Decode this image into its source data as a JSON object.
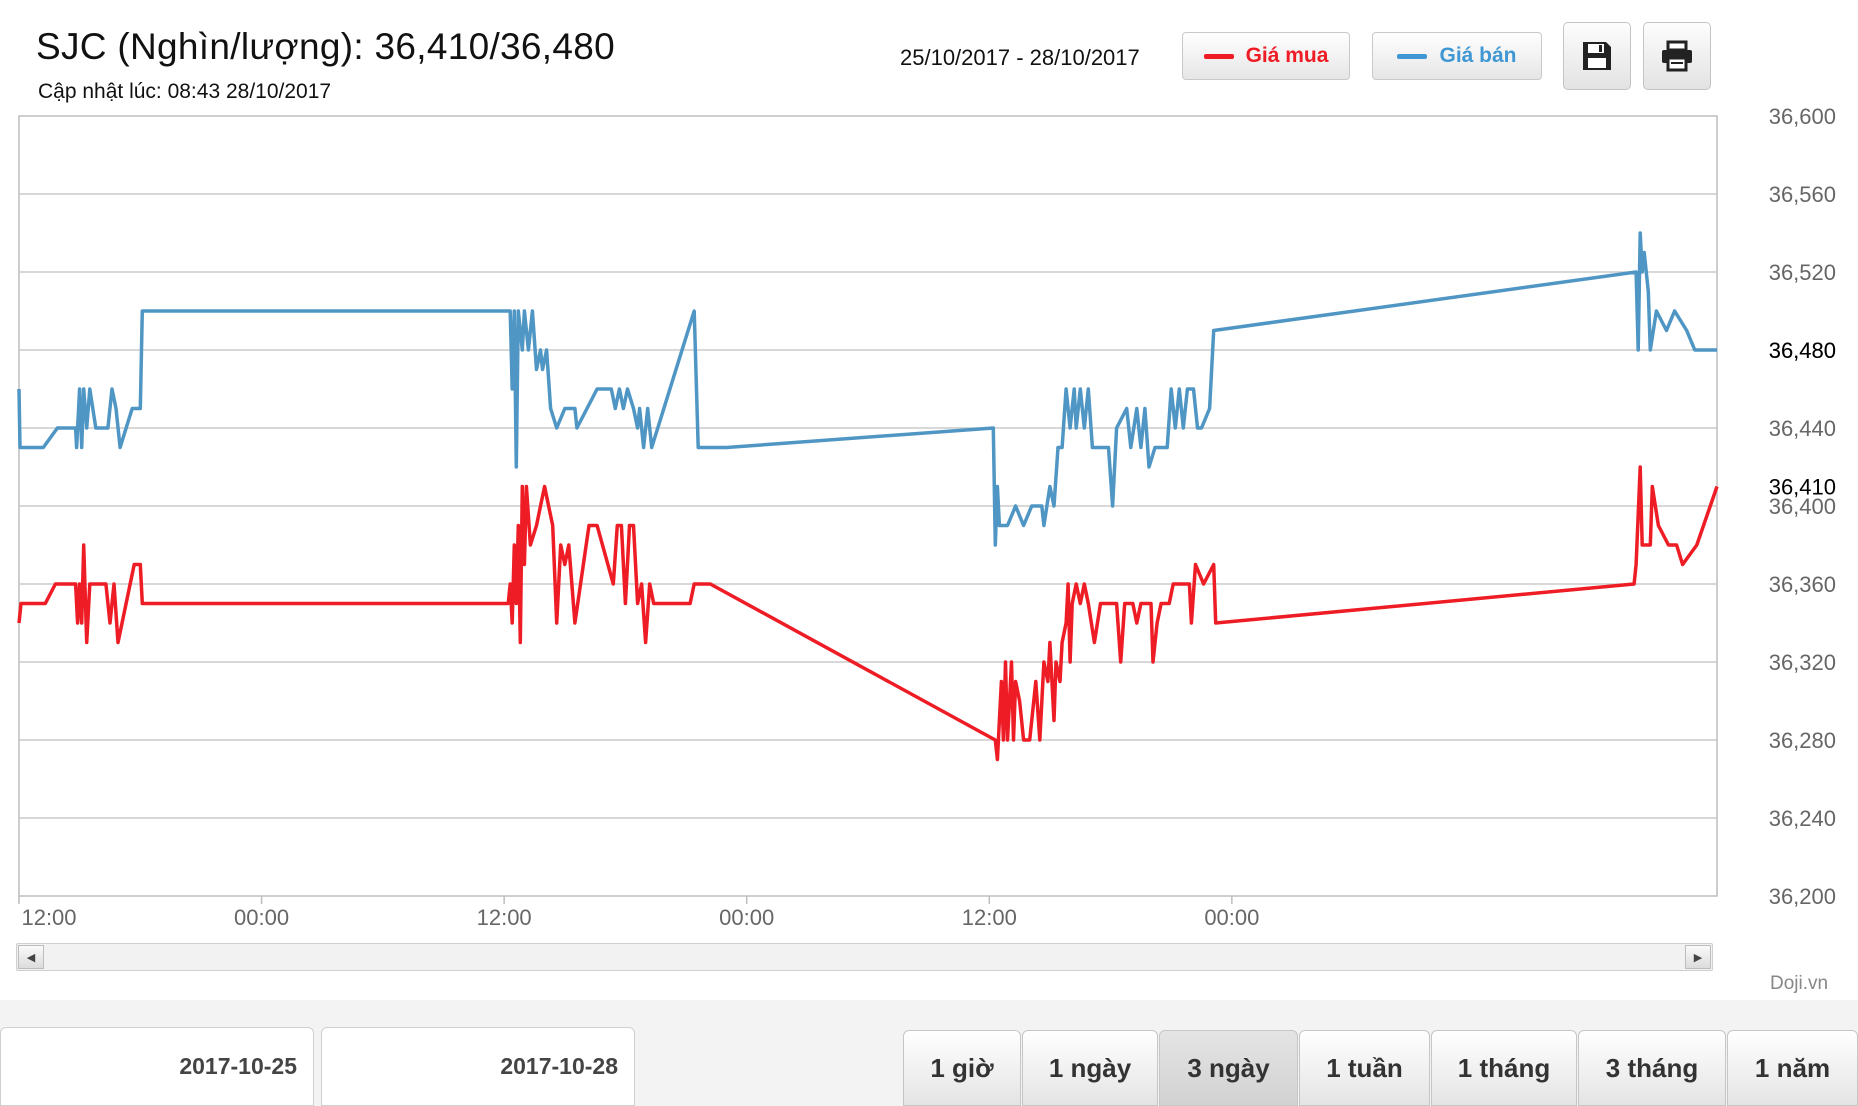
{
  "header": {
    "title": "SJC (Nghìn/lượng): 36,410/36,480",
    "updated": "Cập nhật lúc: 08:43 28/10/2017",
    "date_range": "25/10/2017 - 28/10/2017"
  },
  "legend": {
    "buy_label": "Giá mua",
    "sell_label": "Giá bán"
  },
  "toolbar": {
    "save_icon": "save-icon",
    "print_icon": "print-icon"
  },
  "watermark": "Doji.vn",
  "date_inputs": {
    "from": "2017-10-25",
    "to": "2017-10-28"
  },
  "ranges": [
    "1 giờ",
    "1 ngày",
    "3 ngày",
    "1 tuần",
    "1 tháng",
    "3 tháng",
    "1 năm"
  ],
  "active_range": "3 ngày",
  "colors": {
    "buy": "#ee1c25",
    "sell": "#4f96c4",
    "grid": "#cccccc"
  },
  "chart_data": {
    "type": "line",
    "ylim": [
      36200,
      36600
    ],
    "y_ticks": [
      "36,200",
      "36,240",
      "36,280",
      "36,320",
      "36,360",
      "36,400",
      "36,440",
      "36,480",
      "36,520",
      "36,560",
      "36,600"
    ],
    "x_ticks": [
      "12:00",
      "00:00",
      "12:00",
      "00:00",
      "12:00",
      "00:00"
    ],
    "x_unit": "hours from 25/10/2017 12:00",
    "xlim": [
      0,
      84
    ],
    "current": {
      "buy": 36410,
      "sell": 36480,
      "buy_label": "36,410",
      "sell_label": "36,480"
    },
    "series": [
      {
        "name": "Giá bán",
        "points": [
          [
            0,
            36460
          ],
          [
            0.05,
            36430
          ],
          [
            1.2,
            36430
          ],
          [
            1.9,
            36440
          ],
          [
            2.8,
            36440
          ],
          [
            2.85,
            36430
          ],
          [
            3.0,
            36460
          ],
          [
            3.1,
            36430
          ],
          [
            3.2,
            36460
          ],
          [
            3.35,
            36440
          ],
          [
            3.5,
            36460
          ],
          [
            3.8,
            36440
          ],
          [
            4.4,
            36440
          ],
          [
            4.6,
            36460
          ],
          [
            4.8,
            36450
          ],
          [
            5.0,
            36430
          ],
          [
            5.6,
            36450
          ],
          [
            6.0,
            36450
          ],
          [
            6.1,
            36500
          ],
          [
            24.3,
            36500
          ],
          [
            24.4,
            36460
          ],
          [
            24.5,
            36500
          ],
          [
            24.6,
            36420
          ],
          [
            24.7,
            36500
          ],
          [
            24.9,
            36480
          ],
          [
            25.0,
            36500
          ],
          [
            25.2,
            36480
          ],
          [
            25.4,
            36500
          ],
          [
            25.6,
            36470
          ],
          [
            25.8,
            36480
          ],
          [
            25.9,
            36470
          ],
          [
            26.1,
            36480
          ],
          [
            26.3,
            36450
          ],
          [
            26.6,
            36440
          ],
          [
            27.0,
            36450
          ],
          [
            27.5,
            36450
          ],
          [
            27.6,
            36440
          ],
          [
            28.6,
            36460
          ],
          [
            29.3,
            36460
          ],
          [
            29.5,
            36450
          ],
          [
            29.7,
            36460
          ],
          [
            29.9,
            36450
          ],
          [
            30.1,
            36460
          ],
          [
            30.4,
            36450
          ],
          [
            30.6,
            36440
          ],
          [
            30.7,
            36450
          ],
          [
            30.9,
            36430
          ],
          [
            31.1,
            36450
          ],
          [
            31.3,
            36430
          ],
          [
            33.4,
            36500
          ],
          [
            33.6,
            36430
          ],
          [
            35.0,
            36430
          ],
          [
            48.2,
            36440
          ],
          [
            48.3,
            36380
          ],
          [
            48.4,
            36410
          ],
          [
            48.5,
            36390
          ],
          [
            48.9,
            36390
          ],
          [
            49.3,
            36400
          ],
          [
            49.7,
            36390
          ],
          [
            50.1,
            36400
          ],
          [
            50.6,
            36400
          ],
          [
            50.7,
            36390
          ],
          [
            51.0,
            36410
          ],
          [
            51.2,
            36400
          ],
          [
            51.4,
            36430
          ],
          [
            51.6,
            36430
          ],
          [
            51.8,
            36460
          ],
          [
            52.0,
            36440
          ],
          [
            52.2,
            36460
          ],
          [
            52.3,
            36440
          ],
          [
            52.5,
            36460
          ],
          [
            52.7,
            36440
          ],
          [
            52.9,
            36460
          ],
          [
            53.1,
            36430
          ],
          [
            53.9,
            36430
          ],
          [
            54.1,
            36400
          ],
          [
            54.3,
            36440
          ],
          [
            54.8,
            36450
          ],
          [
            55.0,
            36430
          ],
          [
            55.3,
            36450
          ],
          [
            55.5,
            36430
          ],
          [
            55.7,
            36450
          ],
          [
            55.9,
            36420
          ],
          [
            56.2,
            36430
          ],
          [
            56.8,
            36430
          ],
          [
            57.0,
            36460
          ],
          [
            57.2,
            36440
          ],
          [
            57.4,
            36460
          ],
          [
            57.6,
            36440
          ],
          [
            57.8,
            36460
          ],
          [
            58.1,
            36460
          ],
          [
            58.3,
            36440
          ],
          [
            58.5,
            36440
          ],
          [
            58.9,
            36450
          ],
          [
            59.1,
            36490
          ],
          [
            80.0,
            36520
          ],
          [
            80.1,
            36480
          ],
          [
            80.2,
            36540
          ],
          [
            80.3,
            36520
          ],
          [
            80.4,
            36530
          ],
          [
            80.6,
            36510
          ],
          [
            80.7,
            36480
          ],
          [
            81.0,
            36500
          ],
          [
            81.5,
            36490
          ],
          [
            81.9,
            36500
          ],
          [
            82.5,
            36490
          ],
          [
            82.9,
            36480
          ],
          [
            84.0,
            36480
          ]
        ]
      },
      {
        "name": "Giá mua",
        "points": [
          [
            0,
            36340
          ],
          [
            0.1,
            36350
          ],
          [
            1.3,
            36350
          ],
          [
            1.8,
            36360
          ],
          [
            2.8,
            36360
          ],
          [
            2.9,
            36340
          ],
          [
            3.0,
            36360
          ],
          [
            3.1,
            36340
          ],
          [
            3.2,
            36380
          ],
          [
            3.35,
            36330
          ],
          [
            3.5,
            36360
          ],
          [
            3.8,
            36360
          ],
          [
            4.3,
            36360
          ],
          [
            4.5,
            36340
          ],
          [
            4.7,
            36360
          ],
          [
            4.9,
            36330
          ],
          [
            5.3,
            36350
          ],
          [
            5.7,
            36370
          ],
          [
            6.0,
            36370
          ],
          [
            6.1,
            36350
          ],
          [
            24.2,
            36350
          ],
          [
            24.3,
            36360
          ],
          [
            24.4,
            36340
          ],
          [
            24.5,
            36380
          ],
          [
            24.6,
            36350
          ],
          [
            24.7,
            36390
          ],
          [
            24.8,
            36330
          ],
          [
            24.9,
            36410
          ],
          [
            25.0,
            36370
          ],
          [
            25.1,
            36410
          ],
          [
            25.3,
            36380
          ],
          [
            25.6,
            36390
          ],
          [
            25.8,
            36400
          ],
          [
            26.0,
            36410
          ],
          [
            26.2,
            36400
          ],
          [
            26.4,
            36390
          ],
          [
            26.6,
            36340
          ],
          [
            26.8,
            36380
          ],
          [
            27.0,
            36370
          ],
          [
            27.2,
            36380
          ],
          [
            27.5,
            36340
          ],
          [
            28.2,
            36390
          ],
          [
            28.6,
            36390
          ],
          [
            29.4,
            36360
          ],
          [
            29.6,
            36390
          ],
          [
            29.8,
            36390
          ],
          [
            30.0,
            36350
          ],
          [
            30.2,
            36390
          ],
          [
            30.4,
            36390
          ],
          [
            30.6,
            36350
          ],
          [
            30.8,
            36360
          ],
          [
            31.0,
            36330
          ],
          [
            31.2,
            36360
          ],
          [
            31.4,
            36350
          ],
          [
            33.2,
            36350
          ],
          [
            33.4,
            36360
          ],
          [
            34.2,
            36360
          ],
          [
            48.3,
            36280
          ],
          [
            48.4,
            36270
          ],
          [
            48.6,
            36310
          ],
          [
            48.7,
            36280
          ],
          [
            48.8,
            36320
          ],
          [
            48.9,
            36280
          ],
          [
            49.1,
            36320
          ],
          [
            49.2,
            36280
          ],
          [
            49.3,
            36310
          ],
          [
            49.5,
            36300
          ],
          [
            49.7,
            36280
          ],
          [
            50.0,
            36280
          ],
          [
            50.3,
            36310
          ],
          [
            50.5,
            36280
          ],
          [
            50.7,
            36320
          ],
          [
            50.9,
            36310
          ],
          [
            51.0,
            36330
          ],
          [
            51.2,
            36290
          ],
          [
            51.3,
            36320
          ],
          [
            51.5,
            36310
          ],
          [
            51.6,
            36330
          ],
          [
            51.8,
            36340
          ],
          [
            51.9,
            36360
          ],
          [
            52.0,
            36320
          ],
          [
            52.1,
            36350
          ],
          [
            52.3,
            36360
          ],
          [
            52.5,
            36350
          ],
          [
            52.7,
            36360
          ],
          [
            52.9,
            36350
          ],
          [
            53.2,
            36330
          ],
          [
            53.5,
            36350
          ],
          [
            54.3,
            36350
          ],
          [
            54.5,
            36320
          ],
          [
            54.7,
            36350
          ],
          [
            55.1,
            36350
          ],
          [
            55.3,
            36340
          ],
          [
            55.5,
            36350
          ],
          [
            56.0,
            36350
          ],
          [
            56.1,
            36320
          ],
          [
            56.3,
            36340
          ],
          [
            56.5,
            36350
          ],
          [
            56.9,
            36350
          ],
          [
            57.1,
            36360
          ],
          [
            57.9,
            36360
          ],
          [
            58.0,
            36340
          ],
          [
            58.2,
            36370
          ],
          [
            58.6,
            36360
          ],
          [
            59.1,
            36370
          ],
          [
            59.2,
            36340
          ],
          [
            79.9,
            36360
          ],
          [
            80.0,
            36370
          ],
          [
            80.2,
            36420
          ],
          [
            80.3,
            36380
          ],
          [
            80.7,
            36380
          ],
          [
            80.8,
            36410
          ],
          [
            81.1,
            36390
          ],
          [
            81.6,
            36380
          ],
          [
            82.0,
            36380
          ],
          [
            82.3,
            36370
          ],
          [
            83.0,
            36380
          ],
          [
            84.0,
            36410
          ]
        ]
      }
    ]
  }
}
